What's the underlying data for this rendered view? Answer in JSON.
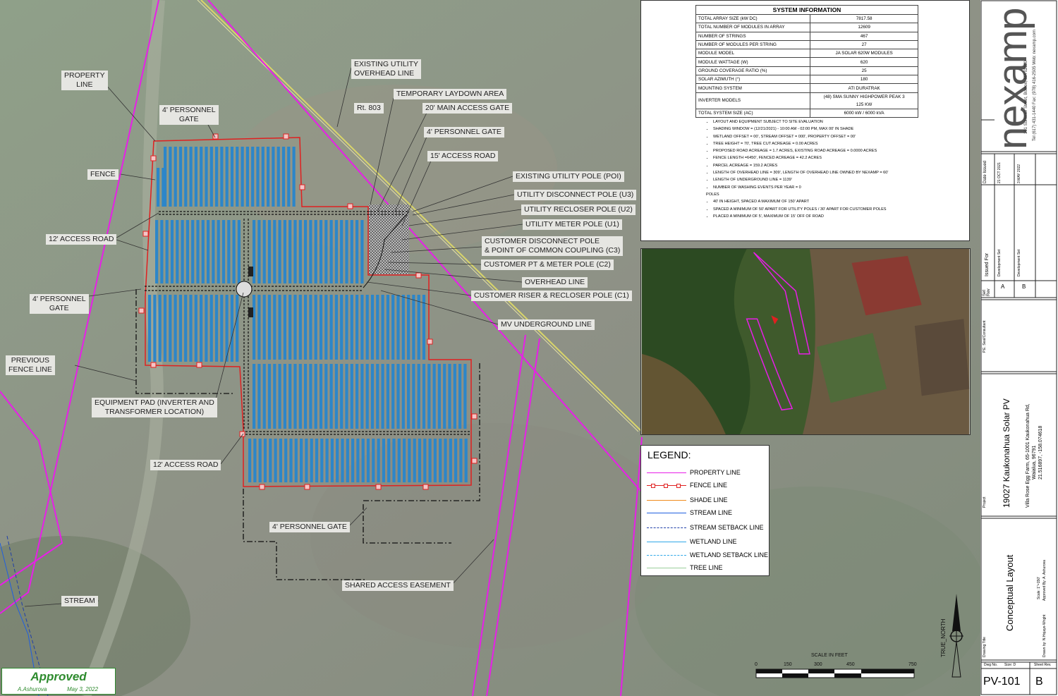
{
  "map_labels": {
    "property_line": "PROPERTY\nLINE",
    "existing_utility_overhead_line": "EXISTING UTILITY\nOVERHEAD LINE",
    "temporary_laydown_area": "TEMPORARY LAYDOWN AREA",
    "rt_803": "Rt. 803",
    "main_access_gate": "20' MAIN ACCESS GATE",
    "personnel_gate_top_left": "4' PERSONNEL\nGATE",
    "personnel_gate_top_right": "4' PERSONNEL GATE",
    "access_road_15": "15' ACCESS ROAD",
    "fence": "FENCE",
    "existing_utility_pole": "EXISTING UTILITY POLE (POI)",
    "utility_disconnect_pole": "UTILITY DISCONNECT POLE (U3)",
    "utility_recloser_pole": "UTILITY RECLOSER POLE (U2)",
    "utility_meter_pole": "UTILITY METER POLE (U1)",
    "access_road_12_top": "12' ACCESS ROAD",
    "customer_disconnect_pole": "CUSTOMER DISCONNECT POLE\n& POINT OF COMMON COUPLING (C3)",
    "customer_pt_meter_pole": "CUSTOMER PT & METER POLE (C2)",
    "overhead_line": "OVERHEAD LINE",
    "personnel_gate_left": "4' PERSONNEL\nGATE",
    "customer_riser_pole": "CUSTOMER RISER & RECLOSER POLE (C1)",
    "mv_underground_line": "MV UNDERGROUND LINE",
    "previous_fence_line": "PREVIOUS\nFENCE LINE",
    "equipment_pad": "EQUIPMENT PAD (INVERTER AND\nTRANSFORMER LOCATION)",
    "access_road_12_bottom": "12' ACCESS ROAD",
    "personnel_gate_bottom": "4' PERSONNEL GATE",
    "shared_access_easement": "SHARED ACCESS EASEMENT",
    "stream": "STREAM",
    "true_north": "TRUE_NORTH"
  },
  "system_information": {
    "title": "SYSTEM INFORMATION",
    "rows": [
      [
        "TOTAL ARRAY SIZE (kW DC)",
        "7817.58"
      ],
      [
        "TOTAL NUMBER OF MODULES IN ARRAY",
        "12609"
      ],
      [
        "NUMBER OF STRINGS",
        "467"
      ],
      [
        "NUMBER OF MODULES PER STRING",
        "27"
      ],
      [
        "MODULE MODEL",
        "JA SOLAR 620W MODULES"
      ],
      [
        "MODULE WATTAGE (W)",
        "620"
      ],
      [
        "GROUND COVERAGE RATIO (%)",
        "25"
      ],
      [
        "SOLAR AZIMUTH (°)",
        "180"
      ],
      [
        "MOUNTING SYSTEM",
        "ATI DURATRAK"
      ],
      [
        "INVERTER MODELS",
        "(48) SMA SUNNY HIGHPOWER PEAK 3\n125 KW"
      ],
      [
        "TOTAL SYSTEM SIZE (AC)",
        "6000 kW / 6000 kVA"
      ]
    ],
    "notes": [
      "LAYOUT AND EQUIPMENT SUBJECT TO SITE EVALUATION",
      "SHADING WINDOW = (12/21/2021) - 10:00 AM - 02:00 PM, MAX 00' IN SHADE",
      "WETLAND OFFSET = 00', STREAM OFFSET = 000', PROPERTY OFFSET = 00'",
      "TREE HEIGHT = 70', TREE CUT ACREAGE = 0.00 ACRES",
      "PROPOSED ROAD ACREAGE = 1.7 ACRES, EXISTING ROAD ACREAGE = 0.0000 ACRES",
      "FENCE LENGTH =6450', FENCED ACREAGE = 42.2 ACRES",
      "PARCEL ACREAGE = 159.2 ACRES",
      "LENGTH OF OVERHEAD LINE = 309', LENGTH OF OVERHEAD LINE OWNED BY NEXAMP = 60'",
      "LENGTH OF UNDERGROUND LINE = 1139'",
      "NUMBER OF WASHING EVENTS PER YEAR = 0"
    ],
    "poles_heading": "POLES",
    "pole_notes": [
      "40' IN HEIGHT, SPACED A MAXIMUM OF 150' APART",
      "SPACED A MINIMUM OF 50' APART FOR UTILITY POLES / 30' APART FOR CUSTOMER POLES",
      "PLACED A MINIMUM OF 5', MAXIMUM OF 15' OFF OF ROAD"
    ]
  },
  "legend": {
    "title": "LEGEND:",
    "items": [
      {
        "label": "PROPERTY LINE",
        "color": "#e81ee8",
        "style": "solid"
      },
      {
        "label": "FENCE LINE",
        "color": "#e02020",
        "style": "fence"
      },
      {
        "label": "SHADE LINE",
        "color": "#f08a1c",
        "style": "solid"
      },
      {
        "label": "STREAM LINE",
        "color": "#1f5fe0",
        "style": "solid"
      },
      {
        "label": "STREAM SETBACK LINE",
        "color": "#1f3fa8",
        "style": "dashed"
      },
      {
        "label": "WETLAND LINE",
        "color": "#2fa8e8",
        "style": "solid"
      },
      {
        "label": "WETLAND SETBACK LINE",
        "color": "#2fa8e8",
        "style": "dashed"
      },
      {
        "label": "TREE LINE",
        "color": "#9acd9a",
        "style": "solid"
      }
    ]
  },
  "scale": {
    "title": "SCALE IN FEET",
    "ticks": [
      "0",
      "150",
      "300",
      "450",
      "750"
    ]
  },
  "title_block": {
    "company": "nexamp",
    "address": "101 Summer Street, Boston, MA 02110",
    "phone": "Tel (617) 431-1440  Fax: (978) 416-2505  Web: nexamp.com",
    "date_issued_header": "Date Issued",
    "date_a": "21 OCT 2021",
    "date_b": "3 MAY 2022",
    "issued_for_header": "Issued For",
    "issued_a": "Development Set",
    "issued_b": "Development Set",
    "set_rev_header": "Set\nRev",
    "rev_a": "A",
    "rev_b": "B",
    "pe_stamp": "P.E. Seal/Consultant",
    "project_label": "Project",
    "project_name": "19027 Kaukonahua Solar PV",
    "project_address_1": "Villa Rose Egg Farm, 65-1001 Kaukonahua Rd,",
    "project_address_2": "Waialua, 96791",
    "project_coords": "21.516897, -158.074618",
    "drawing_title_label": "Drawing Title",
    "drawing_title": "Conceptual Layout",
    "scale_note": "Scale: 1\"=150'",
    "drawn_by": "Drawn by: N.Hojaye-Wright",
    "approved_by": "Approved By: A. Ashurova",
    "dwg_no_label": "Dwg No.",
    "size_label": "Size: D",
    "sheet_rev_label": "Sheet Rev.",
    "dwg_no": "PV-101",
    "sheet_rev": "B"
  },
  "approved_stamp": {
    "text": "Approved",
    "name": "A.Ashurova",
    "date": "May 3, 2022"
  }
}
